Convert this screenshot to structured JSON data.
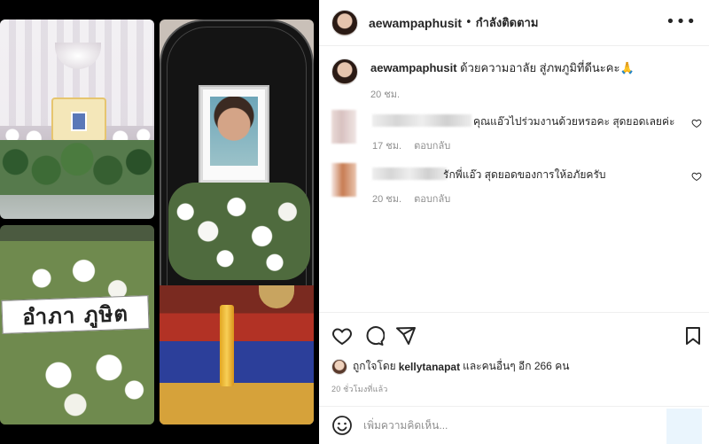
{
  "media": {
    "wreath_card_text": "อำภา ภูษิต"
  },
  "header": {
    "username": "aewampaphusit",
    "separator": "•",
    "follow_status": "กำลังติดตาม",
    "more_icon": "more-horizontal-icon"
  },
  "caption": {
    "username": "aewampaphusit",
    "text": "ด้วยความอาลัย สู่ภพภูมิที่ดีนะคะ🙏",
    "time": "20 ชม."
  },
  "comments": [
    {
      "text": "คุณแอ๊วไปร่วมงานด้วยหรอคะ สุดยอดเลยค่ะ",
      "time": "17 ชม.",
      "reply": "ตอบกลับ"
    },
    {
      "text": "รักพี่แอ๊ว สุดยอดของการให้อภัยครับ",
      "time": "20 ชม.",
      "reply": "ตอบกลับ"
    }
  ],
  "likes": {
    "prefix": "ถูกใจโดย",
    "user": "kellytanapat",
    "suffix": "และคนอื่นๆ อีก 266 คน"
  },
  "post_time": "20 ชั่วโมงที่แล้ว",
  "comment_box": {
    "placeholder": "เพิ่มความคิดเห็น..."
  }
}
